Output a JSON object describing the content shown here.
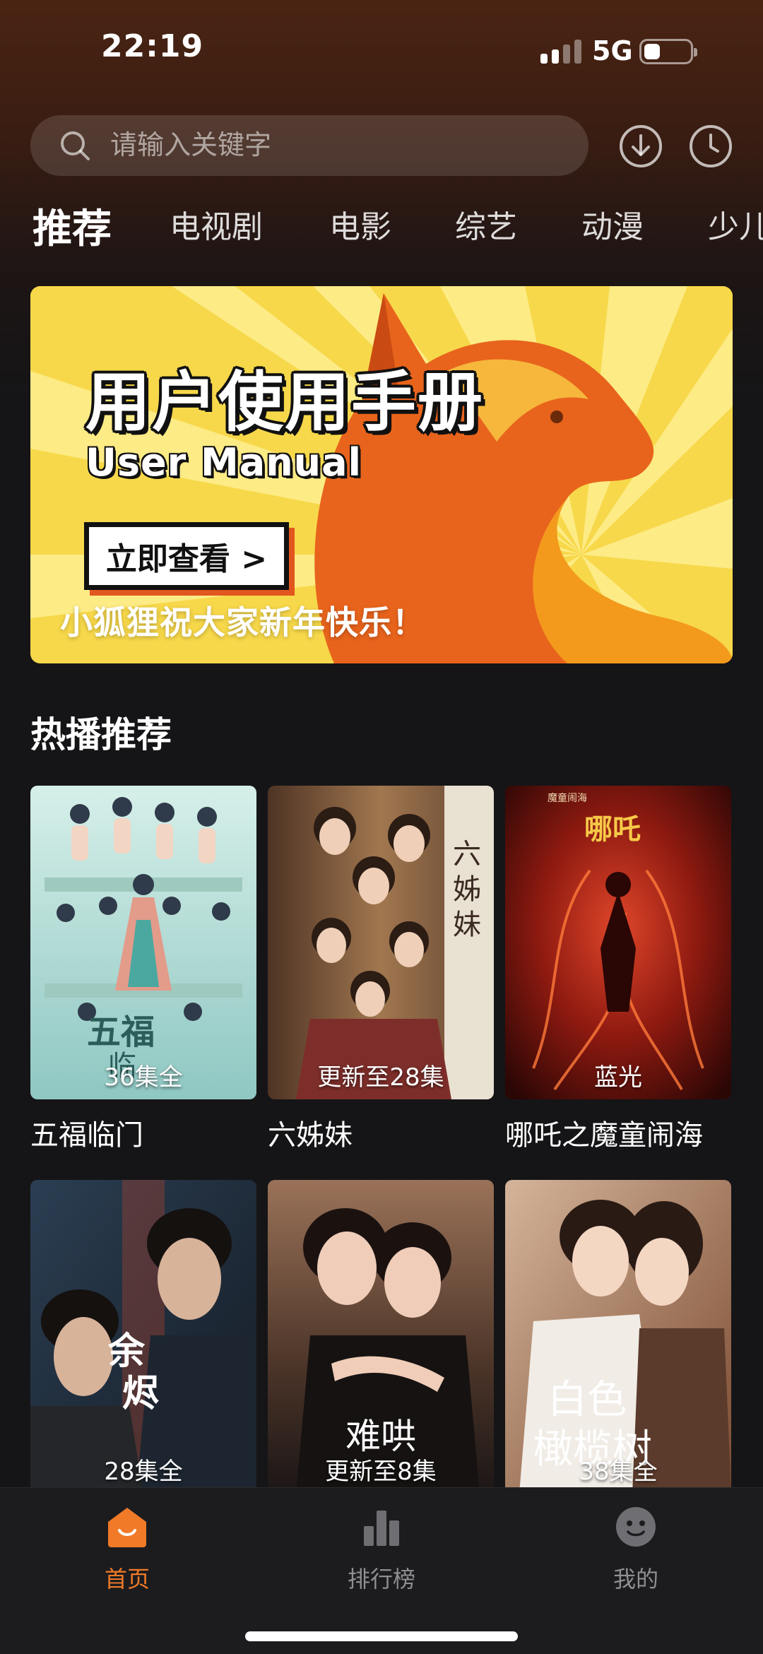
{
  "status_bar": {
    "time": "22:19",
    "network": "5G",
    "signal_bars": 4,
    "signal_bars_active": 2,
    "battery_level": 0.25
  },
  "search": {
    "placeholder": "请输入关键字",
    "icon": "search-icon"
  },
  "header_actions": [
    {
      "icon": "download-icon"
    },
    {
      "icon": "history-clock-icon"
    }
  ],
  "tabs": [
    {
      "label": "推荐",
      "active": true
    },
    {
      "label": "电视剧",
      "active": false
    },
    {
      "label": "电影",
      "active": false
    },
    {
      "label": "综艺",
      "active": false
    },
    {
      "label": "动漫",
      "active": false
    },
    {
      "label": "少儿",
      "active": false
    }
  ],
  "banner": {
    "title": "用户使用手册",
    "subtitle": "User Manual",
    "cta_label": "立即查看 >",
    "greeting": "小狐狸祝大家新年快乐！",
    "colors": {
      "background": "#f7d84a",
      "rays": "#fdeb85",
      "fox": "#e8641c",
      "accent": "#e2561f"
    }
  },
  "hot_section": {
    "title": "热播推荐",
    "items": [
      {
        "title": "五福临门",
        "badge": "36集全",
        "poster_colors": [
          "#bfe3dc",
          "#8fc7c2"
        ]
      },
      {
        "title": "六姊妹",
        "badge": "更新至28集",
        "poster_colors": [
          "#6b4a32",
          "#a1774f"
        ]
      },
      {
        "title": "哪吒之魔童闹海",
        "badge": "蓝光",
        "poster_colors": [
          "#3a0a08",
          "#b3261a"
        ]
      },
      {
        "title": "",
        "badge": "28集全",
        "poster_colors": [
          "#1e2b3a",
          "#3b4d5e"
        ]
      },
      {
        "title": "",
        "badge": "更新至8集",
        "poster_colors": [
          "#5a3c2c",
          "#1f1a1a"
        ]
      },
      {
        "title": "",
        "badge": "38集全",
        "poster_colors": [
          "#c9a58b",
          "#8f5a3a"
        ]
      }
    ]
  },
  "bottom_nav": [
    {
      "label": "首页",
      "icon": "home-icon",
      "active": true
    },
    {
      "label": "排行榜",
      "icon": "bar-chart-icon",
      "active": false
    },
    {
      "label": "我的",
      "icon": "profile-smiley-icon",
      "active": false
    }
  ],
  "accent_color": "#f07a28"
}
